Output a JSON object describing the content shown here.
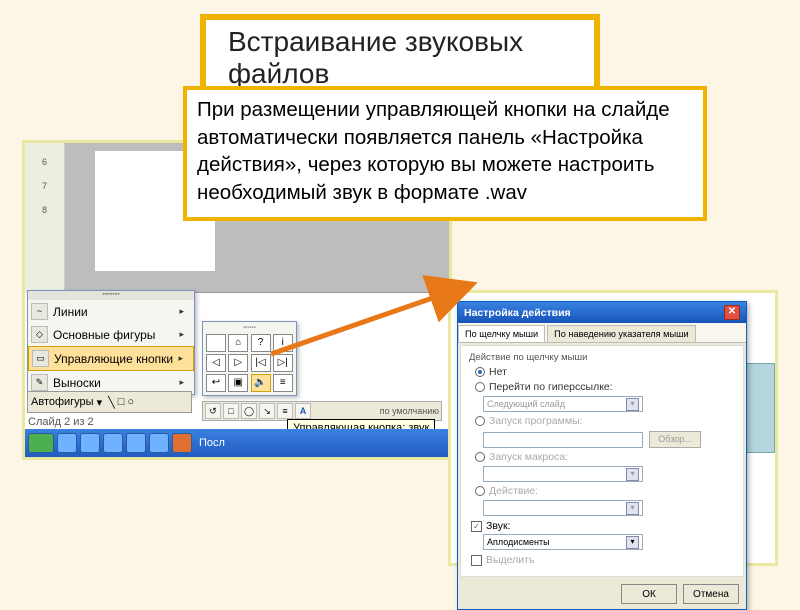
{
  "title": "Встраивание звуковых файлов",
  "description": "При размещении управляющей кнопки на слайде автоматически появляется панель «Настройка действия», через которую вы можете настроить необходимый звук в формате .wav",
  "ruler_marks": [
    "6",
    "7",
    "8"
  ],
  "autoshapes": {
    "menu_items": [
      {
        "icon": "~",
        "label": "Линии"
      },
      {
        "icon": "◇",
        "label": "Основные фигуры"
      },
      {
        "icon": "▭",
        "label": "Управляющие кнопки",
        "highlight": true
      },
      {
        "icon": "✎",
        "label": "Выноски"
      }
    ],
    "toolbar_label": "Автофигуры",
    "grid_buttons": [
      "",
      "⌂",
      "?",
      "i",
      "◁",
      "▷",
      "|◁",
      "▷|",
      "↩",
      "▣",
      "🔈",
      "≡"
    ],
    "selected_index": 10,
    "tooltip": "Управляющая кнопка: звук"
  },
  "format_toolbar": [
    "↺",
    "□",
    "◯",
    "↘",
    "≡",
    "A"
  ],
  "slide_counter": "Слайд 2 из 2",
  "default_text": "по умолчанию",
  "taskbar": {
    "app_label": "Посл"
  },
  "dialog": {
    "title": "Настройка действия",
    "tabs": [
      "По щелчку мыши",
      "По наведению указателя мыши"
    ],
    "active_tab": 0,
    "section": "Действие по щелчку мыши",
    "radios": {
      "none": "Нет",
      "hyperlink": "Перейти по гиперссылке:",
      "hyperlink_value": "Следующий слайд",
      "program": "Запуск программы:",
      "browse": "Обзор...",
      "macro": "Запуск макроса:",
      "action": "Действие:"
    },
    "sound_check": "Звук:",
    "sound_value": "Аплодисменты",
    "highlight_check": "Выделить",
    "ok": "ОК",
    "cancel": "Отмена"
  }
}
